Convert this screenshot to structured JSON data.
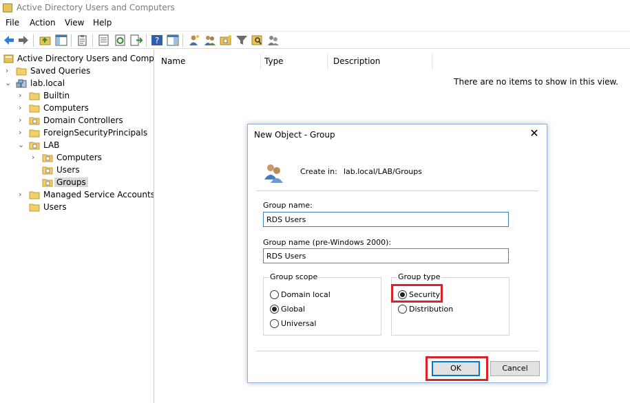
{
  "window": {
    "title": "Active Directory Users and Computers"
  },
  "menu": {
    "items": [
      "File",
      "Action",
      "View",
      "Help"
    ]
  },
  "tree": {
    "root": "Active Directory Users and Computers",
    "saved_queries": "Saved Queries",
    "domain": "lab.local",
    "builtin": "Builtin",
    "computers": "Computers",
    "domain_controllers": "Domain Controllers",
    "foreign_security_principals": "ForeignSecurityPrincipals",
    "lab": "LAB",
    "lab_computers": "Computers",
    "lab_users": "Users",
    "lab_groups": "Groups",
    "managed_service_accounts": "Managed Service Accounts",
    "users": "Users"
  },
  "list": {
    "columns": [
      "Name",
      "Type",
      "Description"
    ],
    "empty_message": "There are no items to show in this view."
  },
  "dialog": {
    "title": "New Object - Group",
    "create_in_label": "Create in:",
    "create_in_path": "lab.local/LAB/Groups",
    "group_name_label": "Group name:",
    "group_name_value": "RDS Users",
    "group_name_pre2000_label": "Group name (pre-Windows 2000):",
    "group_name_pre2000_value": "RDS Users",
    "group_scope": {
      "title": "Group scope",
      "options": [
        "Domain local",
        "Global",
        "Universal"
      ],
      "selected": "Global"
    },
    "group_type": {
      "title": "Group type",
      "options": [
        "Security",
        "Distribution"
      ],
      "selected": "Security"
    },
    "ok_label": "OK",
    "cancel_label": "Cancel"
  },
  "colors": {
    "highlight": "#d8232a",
    "folder": "#e9c25a",
    "accent": "#0078d7"
  }
}
